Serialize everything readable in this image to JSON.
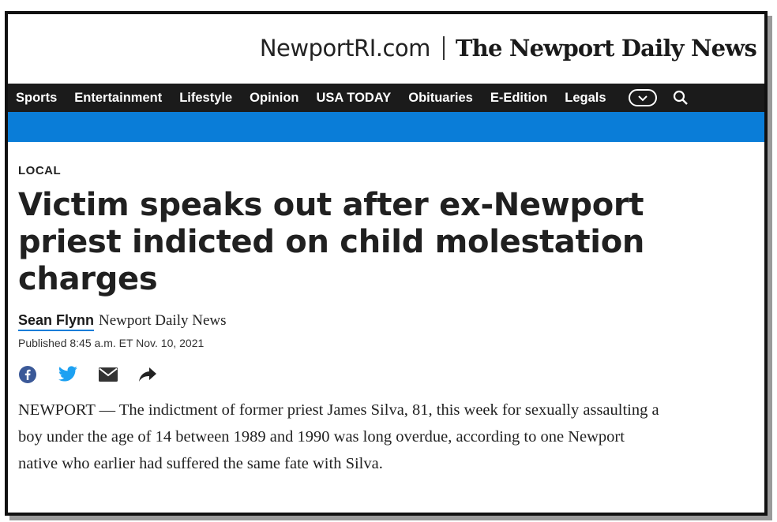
{
  "masthead": {
    "site_name": "NewportRI.com",
    "paper_name": "The Newport Daily News"
  },
  "nav": {
    "items": [
      "Sports",
      "Entertainment",
      "Lifestyle",
      "Opinion",
      "USA TODAY",
      "Obituaries",
      "E-Edition",
      "Legals"
    ],
    "more_icon": "chevron-down-icon",
    "search_icon": "search-icon"
  },
  "colors": {
    "accent_blue": "#0a7dd8",
    "nav_background": "#1b1b1b",
    "facebook": "#3b5998",
    "twitter": "#1da1f2"
  },
  "article": {
    "section": "LOCAL",
    "headline": "Victim speaks out after ex-Newport priest indicted on child molestation charges",
    "author": "Sean Flynn",
    "publisher": "Newport Daily News",
    "published": "Published 8:45 a.m. ET Nov. 10, 2021",
    "share_icons": [
      "facebook-icon",
      "twitter-icon",
      "email-icon",
      "share-icon"
    ],
    "body": "NEWPORT — The indictment of former priest James Silva, 81, this week for sexually assaulting a boy under the age of 14 between 1989 and 1990 was long overdue, according to one Newport native who earlier had suffered the same fate with Silva."
  }
}
